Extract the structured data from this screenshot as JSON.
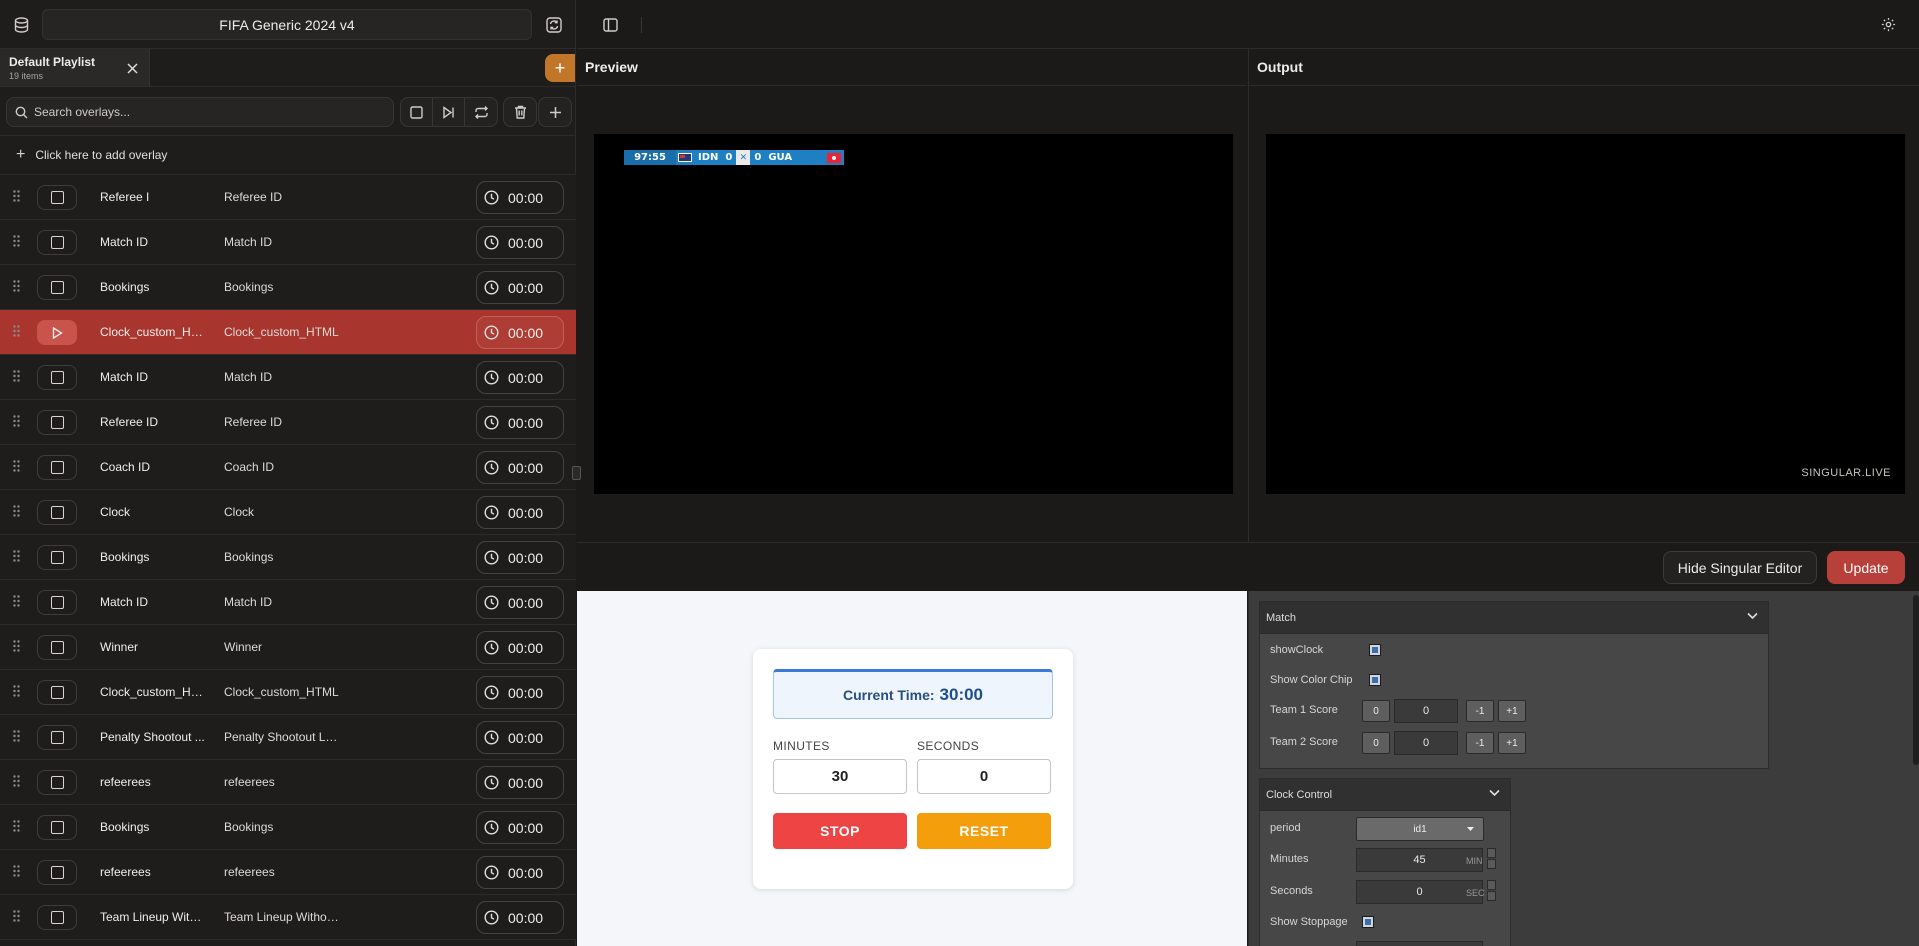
{
  "project": {
    "title": "FIFA Generic 2024 v4"
  },
  "playlist": {
    "name": "Default Playlist",
    "count": "19 items"
  },
  "search": {
    "placeholder": "Search overlays..."
  },
  "add_overlay_label": "Click here to add overlay",
  "rows": [
    {
      "name": "Referee I",
      "overlay": "Referee ID",
      "time": "00:00",
      "active": false
    },
    {
      "name": "Match ID",
      "overlay": "Match ID",
      "time": "00:00",
      "active": false
    },
    {
      "name": "Bookings",
      "overlay": "Bookings",
      "time": "00:00",
      "active": false
    },
    {
      "name": "Clock_custom_HT...",
      "overlay": "Clock_custom_HTML",
      "time": "00:00",
      "active": true
    },
    {
      "name": "Match ID",
      "overlay": "Match ID",
      "time": "00:00",
      "active": false
    },
    {
      "name": "Referee ID",
      "overlay": "Referee ID",
      "time": "00:00",
      "active": false
    },
    {
      "name": "Coach ID",
      "overlay": "Coach ID",
      "time": "00:00",
      "active": false
    },
    {
      "name": "Clock",
      "overlay": "Clock",
      "time": "00:00",
      "active": false
    },
    {
      "name": "Bookings",
      "overlay": "Bookings",
      "time": "00:00",
      "active": false
    },
    {
      "name": "Match ID",
      "overlay": "Match ID",
      "time": "00:00",
      "active": false
    },
    {
      "name": "Winner",
      "overlay": "Winner",
      "time": "00:00",
      "active": false
    },
    {
      "name": "Clock_custom_HT...",
      "overlay": "Clock_custom_HTML",
      "time": "00:00",
      "active": false
    },
    {
      "name": "Penalty Shootout ...",
      "overlay": "Penalty Shootout Lo...",
      "time": "00:00",
      "active": false
    },
    {
      "name": "refeerees",
      "overlay": "refeerees",
      "time": "00:00",
      "active": false
    },
    {
      "name": "Bookings",
      "overlay": "Bookings",
      "time": "00:00",
      "active": false
    },
    {
      "name": "refeerees",
      "overlay": "refeerees",
      "time": "00:00",
      "active": false
    },
    {
      "name": "Team Lineup With...",
      "overlay": "Team Lineup Withou...",
      "time": "00:00",
      "active": false
    }
  ],
  "panes": {
    "preview": "Preview",
    "output": "Output",
    "brand": "SINGULAR.LIVE"
  },
  "scorebug": {
    "clock": "97:55",
    "team1": "IDN",
    "score1": "0",
    "team2": "GUA",
    "score2": "0"
  },
  "actions": {
    "hide_editor": "Hide Singular Editor",
    "update": "Update"
  },
  "clock_widget": {
    "current_label": "Current Time:",
    "current_value": "30:00",
    "minutes_label": "MINUTES",
    "seconds_label": "SECONDS",
    "minutes_value": "30",
    "seconds_value": "0",
    "stop_label": "STOP",
    "reset_label": "RESET",
    "stop_color": "#ef4444",
    "reset_color": "#f59e0b"
  },
  "editor": {
    "match": {
      "title": "Match",
      "show_clock": "showClock",
      "show_color_chip": "Show Color Chip",
      "team1_score": "Team 1 Score",
      "team2_score": "Team 2 Score",
      "zero": "0",
      "team1_value": "0",
      "team2_value": "0",
      "minus": "-1",
      "plus": "+1"
    },
    "clock_control": {
      "title": "Clock Control",
      "period_label": "period",
      "period_value": "id1",
      "minutes_label": "Minutes",
      "minutes_value": "45",
      "minutes_unit": "MIN",
      "seconds_label": "Seconds",
      "seconds_value": "0",
      "seconds_unit": "SEC",
      "show_stoppage": "Show Stoppage"
    }
  }
}
